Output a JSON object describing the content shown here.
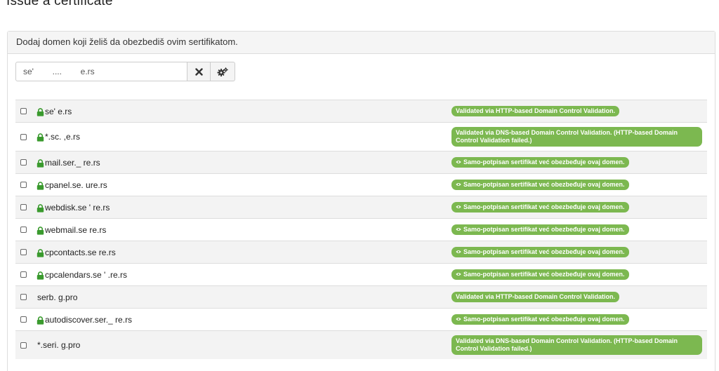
{
  "page": {
    "title": "Issue a certificate"
  },
  "panel": {
    "heading": "Dodaj domen koji želiš da obezbediš ovim sertifikatom."
  },
  "search": {
    "value": "se'        ....        e.rs",
    "clear_icon": "times-icon",
    "options_icon": "cogs-icon"
  },
  "colors": {
    "badge_green": "#7cb850",
    "lock_green": "#3a9a2e",
    "odd_row": "#f3f3f3"
  },
  "domains": [
    {
      "name": "se'                 e.rs",
      "lock": true,
      "status": "Validated via HTTP-based Domain Control Validation.",
      "eye": false
    },
    {
      "name": "*.sc.                    ,e.rs",
      "lock": true,
      "status": "Validated via DNS-based Domain Control Validation. (HTTP-based Domain Control Validation failed.)",
      "eye": false
    },
    {
      "name": "mail.ser._              re.rs",
      "lock": true,
      "status": "Samo-potpisan sertifikat već obezbeđuje ovaj domen.",
      "eye": true
    },
    {
      "name": "cpanel.se.            ure.rs",
      "lock": true,
      "status": "Samo-potpisan sertifikat već obezbeđuje ovaj domen.",
      "eye": true
    },
    {
      "name": "webdisk.se   '         re.rs",
      "lock": true,
      "status": "Samo-potpisan sertifikat već obezbeđuje ovaj domen.",
      "eye": true
    },
    {
      "name": "webmail.se                re.rs",
      "lock": true,
      "status": "Samo-potpisan sertifikat već obezbeđuje ovaj domen.",
      "eye": true
    },
    {
      "name": "cpcontacts.se              re.rs",
      "lock": true,
      "status": "Samo-potpisan sertifikat već obezbeđuje ovaj domen.",
      "eye": true
    },
    {
      "name": "cpcalendars.se  '        .re.rs",
      "lock": true,
      "status": "Samo-potpisan sertifikat već obezbeđuje ovaj domen.",
      "eye": true
    },
    {
      "name": "serb.                      g.pro",
      "lock": false,
      "status": "Validated via HTTP-based Domain Control Validation.",
      "eye": false
    },
    {
      "name": "autodiscover.ser._          re.rs",
      "lock": true,
      "status": "Samo-potpisan sertifikat već obezbeđuje ovaj domen.",
      "eye": true
    },
    {
      "name": "*.seri.                            g.pro",
      "lock": false,
      "status": "Validated via DNS-based Domain Control Validation. (HTTP-based Domain Control Validation failed.)",
      "eye": false
    }
  ]
}
